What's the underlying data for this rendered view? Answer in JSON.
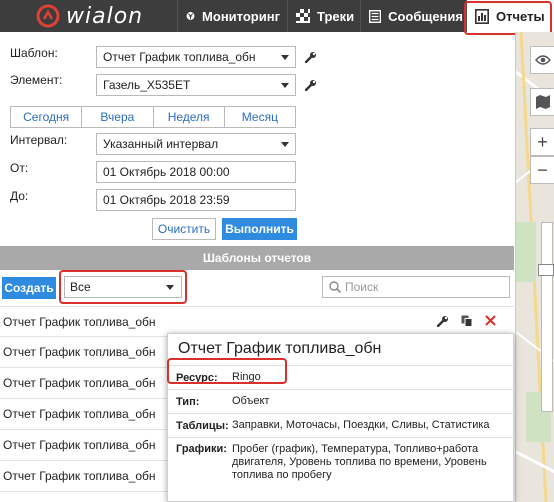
{
  "app": {
    "logo_text": "wialon"
  },
  "nav": {
    "items": [
      {
        "label": "Мониторинг"
      },
      {
        "label": "Треки"
      },
      {
        "label": "Сообщения"
      },
      {
        "label": "Отчеты"
      }
    ]
  },
  "form": {
    "template_label": "Шаблон:",
    "template_value": "Отчет График топлива_обн",
    "element_label": "Элемент:",
    "element_value": "Газель_Х535ЕТ",
    "quick_periods": [
      "Сегодня",
      "Вчера",
      "Неделя",
      "Месяц"
    ],
    "interval_label": "Интервал:",
    "interval_value": "Указанный интервал",
    "from_label": "От:",
    "from_value": "01 Октябрь 2018 00:00",
    "to_label": "До:",
    "to_value": "01 Октябрь 2018 23:59",
    "clear_label": "Очистить",
    "run_label": "Выполнить"
  },
  "templates": {
    "section_title": "Шаблоны отчетов",
    "create_label": "Создать",
    "filter_value": "Все",
    "search_placeholder": "Поиск",
    "rows": [
      "Отчет График топлива_обн",
      "Отчет График топлива_обн",
      "Отчет График топлива_обн",
      "Отчет График топлива_обн",
      "Отчет График топлива_обн",
      "Отчет График топлива_обн"
    ]
  },
  "popup": {
    "title": "Отчет График топлива_обн",
    "resource_label": "Ресурс:",
    "resource_value": "Ringo",
    "type_label": "Тип:",
    "type_value": "Объект",
    "tables_label": "Таблицы:",
    "tables_value": "Заправки, Моточасы, Поездки, Сливы, Статистика",
    "charts_label": "Графики:",
    "charts_value": "Пробег (график), Температура, Топливо+работа двигателя, Уровень топлива по времени, Уровень топлива по пробегу"
  },
  "colors": {
    "accent": "#2e8bdf",
    "highlight": "#d9302b",
    "topbar": "#3d3d3d",
    "delete": "#d9302b"
  }
}
